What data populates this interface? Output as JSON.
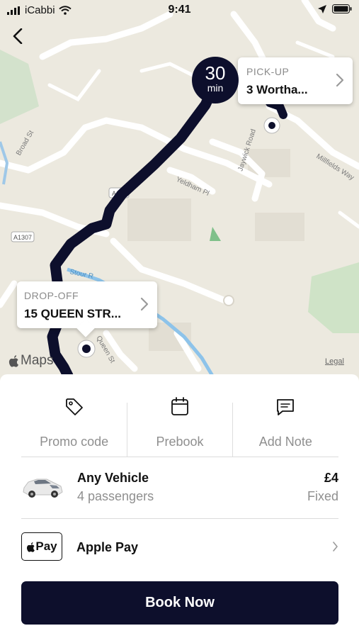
{
  "status_bar": {
    "carrier": "iCabbi",
    "time": "9:41"
  },
  "map": {
    "eta": {
      "value": "30",
      "unit": "min"
    },
    "pickup": {
      "label": "PICK-UP",
      "address": "3 Wortha..."
    },
    "dropoff": {
      "label": "DROP-OFF",
      "address": "15 QUEEN STR..."
    },
    "street_labels": [
      "Broad St",
      "A143",
      "A1307",
      "Stour R",
      "Queen St",
      "Yeldham Pl",
      "Jaywick Road",
      "Millfields Way"
    ],
    "maps_brand": "Maps",
    "legal": "Legal"
  },
  "actions": [
    {
      "label": "Promo code",
      "icon": "tag-icon"
    },
    {
      "label": "Prebook",
      "icon": "calendar-icon"
    },
    {
      "label": "Add Note",
      "icon": "note-icon"
    }
  ],
  "vehicle": {
    "name": "Any Vehicle",
    "passengers": "4 passengers",
    "price": "£4",
    "price_type": "Fixed"
  },
  "payment": {
    "badge": "Pay",
    "method": "Apple Pay"
  },
  "book_button": "Book Now",
  "colors": {
    "brand_navy": "#0d0f2c",
    "map_background": "#ece9df",
    "muted_text": "#8f8f8f"
  }
}
